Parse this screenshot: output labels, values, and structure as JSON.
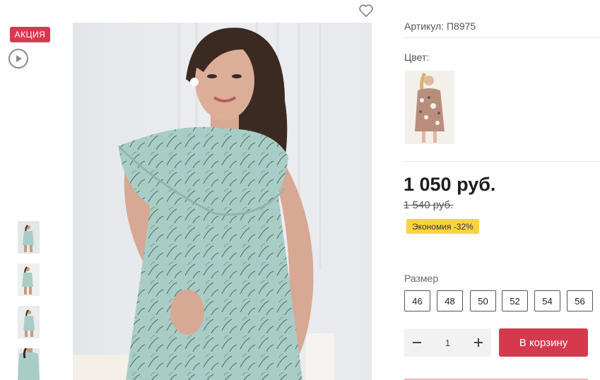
{
  "badge": {
    "label": "АКЦИЯ",
    "color": "#d6394e"
  },
  "media": {
    "play_icon": "play-icon",
    "main_image_alt": "Фото платья",
    "favorite_icon": "heart-icon",
    "thumbnails": [
      "thumb-1",
      "thumb-2",
      "thumb-3",
      "thumb-4"
    ]
  },
  "product": {
    "article": "Артикул: П8975",
    "color_label": "Цвет:",
    "price": "1 050 руб.",
    "old_price": "1 540 руб.",
    "saving": "Экономия -32%",
    "size_label": "Размер",
    "sizes": [
      "46",
      "48",
      "50",
      "52",
      "54",
      "56"
    ]
  },
  "cart": {
    "quantity": "1",
    "minus_icon": "minus-icon",
    "plus_icon": "plus-icon",
    "button_label": "В корзину"
  },
  "colors": {
    "accent": "#d6394e",
    "saving_bg": "#fbd33f",
    "dress_mint": "#a9cdc6"
  }
}
